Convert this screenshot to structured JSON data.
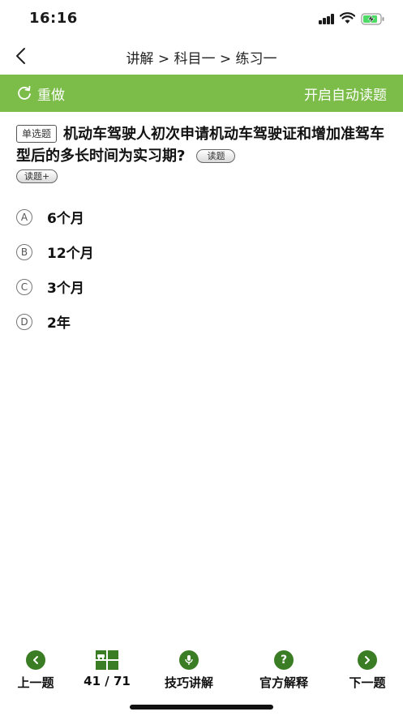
{
  "status_bar": {
    "time": "16:16"
  },
  "nav": {
    "title": "讲解 > 科目一 > 练习一"
  },
  "toolbar": {
    "redo_label": "重做",
    "auto_read_label": "开启自动读题",
    "color": "#7cbd4a"
  },
  "question": {
    "type": "单选题",
    "text": "机动车驾驶人初次申请机动车驾驶证和增加准驾车型后的多长时间为实习期?",
    "read_label": "读题",
    "read_plus_label": "读题+"
  },
  "options": [
    {
      "letter": "A",
      "text": "6个月"
    },
    {
      "letter": "B",
      "text": "12个月"
    },
    {
      "letter": "C",
      "text": "3个月"
    },
    {
      "letter": "D",
      "text": "2年"
    }
  ],
  "bottom_bar": {
    "prev_label": "上一题",
    "progress_label": "41 / 71",
    "tips_label": "技巧讲解",
    "official_label": "官方解释",
    "next_label": "下一题",
    "icon_color": "#3b7d24"
  },
  "icons": [
    "signal-icon",
    "wifi-icon",
    "battery-charging-icon",
    "back-chevron-icon",
    "redo-icon",
    "prev-arrow-icon",
    "grid-icon",
    "microphone-icon",
    "question-mark-icon",
    "next-arrow-icon"
  ]
}
